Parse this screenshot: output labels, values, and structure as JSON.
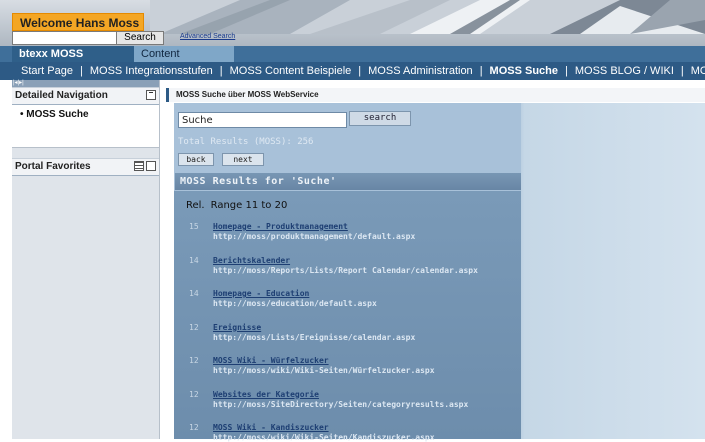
{
  "header": {
    "welcome": "Welcome Hans Moss",
    "search_button": "Search",
    "advanced_search": "Advanced Search"
  },
  "tabs": [
    {
      "label": "btexx MOSS Integration",
      "active": true
    },
    {
      "label": "Content Administration",
      "active": false
    }
  ],
  "subnav": {
    "items": [
      {
        "label": "Start Page"
      },
      {
        "label": "MOSS Integrationsstufen"
      },
      {
        "label": "MOSS Content Beispiele"
      },
      {
        "label": "MOSS Administration"
      },
      {
        "label": "MOSS Suche",
        "active": true
      },
      {
        "label": "MOSS BLOG / WIKI"
      },
      {
        "label": "MOSS Seiten Strukturen"
      }
    ]
  },
  "left_panel": {
    "detailed_navigation_title": "Detailed Navigation",
    "nav_link": "MOSS Suche",
    "portal_favorites_title": "Portal Favorites"
  },
  "main": {
    "header": "MOSS Suche über MOSS WebService",
    "search_value": "Suche",
    "search_button": "search",
    "total_results": "Total Results (MOSS): 256",
    "back_button": "back",
    "next_button": "next",
    "results_title": "MOSS Results for 'Suche'",
    "rel_label": "Rel.",
    "range_label": "Range 11 to 20",
    "results": [
      {
        "score": "15",
        "title": "Homepage - Produktmanagement",
        "url": "http://moss/produktmanagement/default.aspx"
      },
      {
        "score": "14",
        "title": "Berichtskalender",
        "url": "http://moss/Reports/Lists/Report Calendar/calendar.aspx"
      },
      {
        "score": "14",
        "title": "Homepage - Education",
        "url": "http://moss/education/default.aspx"
      },
      {
        "score": "12",
        "title": "Ereignisse",
        "url": "http://moss/Lists/Ereignisse/calendar.aspx"
      },
      {
        "score": "12",
        "title": "MOSS Wiki - Würfelzucker",
        "url": "http://moss/wiki/Wiki-Seiten/Würfelzucker.aspx"
      },
      {
        "score": "12",
        "title": "Websites der Kategorie",
        "url": "http://moss/SiteDirectory/Seiten/categoryresults.aspx"
      },
      {
        "score": "12",
        "title": "MOSS Wiki - Kandiszucker",
        "url": "http://moss/wiki/Wiki-Seiten/Kandiszucker.aspx"
      }
    ]
  }
}
